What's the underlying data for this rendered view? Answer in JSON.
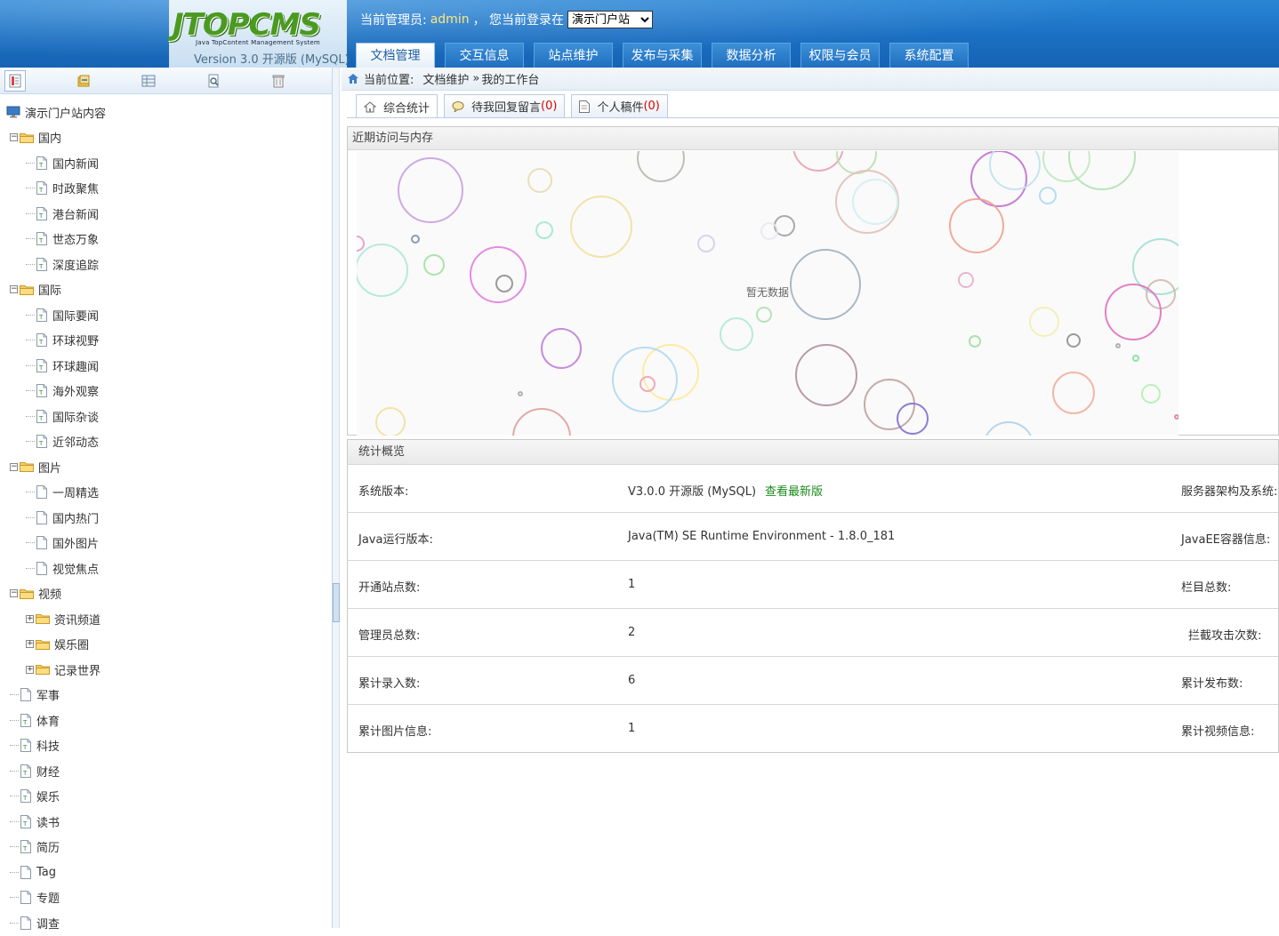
{
  "header": {
    "logo_text": "JTOPCMS",
    "logo_sub": "Java TopContent Management System",
    "version": "Version 3.0  开源版 (MySQL)",
    "admin_prefix": "当前管理员:",
    "admin_name": "admin",
    "login_prefix": "，  您当前登录在",
    "site_selected": "演示门户站",
    "nav": [
      "文档管理",
      "交互信息",
      "站点维护",
      "发布与采集",
      "数据分析",
      "权限与会员",
      "系统配置"
    ],
    "active_nav": 0
  },
  "sidebar": {
    "toolbar_icons": [
      "document-tree-icon",
      "folder-stack-icon",
      "grid-icon",
      "search-document-icon",
      "trash-icon"
    ],
    "root": "演示门户站内容",
    "tree": [
      {
        "label": "国内",
        "type": "folder",
        "depth": 0,
        "expander": "-"
      },
      {
        "label": "国内新闻",
        "type": "page",
        "depth": 1
      },
      {
        "label": "时政聚焦",
        "type": "page",
        "depth": 1
      },
      {
        "label": "港台新闻",
        "type": "page",
        "depth": 1
      },
      {
        "label": "世态万象",
        "type": "page",
        "depth": 1
      },
      {
        "label": "深度追踪",
        "type": "page",
        "depth": 1
      },
      {
        "label": "国际",
        "type": "folder",
        "depth": 0,
        "expander": "-"
      },
      {
        "label": "国际要闻",
        "type": "page",
        "depth": 1
      },
      {
        "label": "环球视野",
        "type": "page",
        "depth": 1
      },
      {
        "label": "环球趣闻",
        "type": "page",
        "depth": 1
      },
      {
        "label": "海外观察",
        "type": "page",
        "depth": 1
      },
      {
        "label": "国际杂谈",
        "type": "page",
        "depth": 1
      },
      {
        "label": "近邻动态",
        "type": "page",
        "depth": 1
      },
      {
        "label": "图片",
        "type": "folder",
        "depth": 0,
        "expander": "-"
      },
      {
        "label": "一周精选",
        "type": "blank",
        "depth": 1
      },
      {
        "label": "国内热门",
        "type": "blank",
        "depth": 1
      },
      {
        "label": "国外图片",
        "type": "blank",
        "depth": 1
      },
      {
        "label": "视觉焦点",
        "type": "blank",
        "depth": 1
      },
      {
        "label": "视频",
        "type": "folder",
        "depth": 0,
        "expander": "-"
      },
      {
        "label": "资讯频道",
        "type": "folder",
        "depth": 1,
        "expander": "+"
      },
      {
        "label": "娱乐圈",
        "type": "folder",
        "depth": 1,
        "expander": "+"
      },
      {
        "label": "记录世界",
        "type": "folder",
        "depth": 1,
        "expander": "+"
      },
      {
        "label": "军事",
        "type": "blank",
        "depth": 0
      },
      {
        "label": "体育",
        "type": "page",
        "depth": 0
      },
      {
        "label": "科技",
        "type": "page",
        "depth": 0
      },
      {
        "label": "财经",
        "type": "page",
        "depth": 0
      },
      {
        "label": "娱乐",
        "type": "page",
        "depth": 0
      },
      {
        "label": "读书",
        "type": "page",
        "depth": 0
      },
      {
        "label": "简历",
        "type": "page",
        "depth": 0
      },
      {
        "label": "Tag",
        "type": "blank",
        "depth": 0
      },
      {
        "label": "专题",
        "type": "blank",
        "depth": 0
      },
      {
        "label": "调查",
        "type": "blank",
        "depth": 0
      }
    ]
  },
  "breadcrumb": {
    "prefix": "当前位置:",
    "path1": "文档维护",
    "sep": "»",
    "path2": "我的工作台"
  },
  "tabs": [
    {
      "label": "综合统计",
      "count": "",
      "active": true,
      "icon": "home-icon"
    },
    {
      "label": "待我回复留言",
      "count": "(0)",
      "active": false,
      "icon": "message-icon"
    },
    {
      "label": "个人稿件",
      "count": "(0)",
      "active": false,
      "icon": "document-icon"
    }
  ],
  "visits_panel": {
    "title": "近期访问与内存",
    "no_data": "暂无数据"
  },
  "stats_panel": {
    "title": "统计概览",
    "rows": [
      {
        "label": "系统版本:",
        "value": "V3.0.0 开源版 (MySQL)",
        "link": "查看最新版",
        "right_label": "服务器架构及系统:"
      },
      {
        "label": "Java运行版本:",
        "value": "Java(TM) SE Runtime Environment - 1.8.0_181",
        "link": "",
        "right_label": "JavaEE容器信息:"
      },
      {
        "label": "开通站点数:",
        "value": "1",
        "link": "",
        "right_label": "栏目总数:"
      },
      {
        "label": "管理员总数:",
        "value": "2",
        "link": "",
        "right_label": "拦截攻击次数:"
      },
      {
        "label": "累计录入数:",
        "value": "6",
        "link": "",
        "right_label": "累计发布数:"
      },
      {
        "label": "累计图片信息:",
        "value": "1",
        "link": "",
        "right_label": "累计视频信息:"
      }
    ]
  }
}
